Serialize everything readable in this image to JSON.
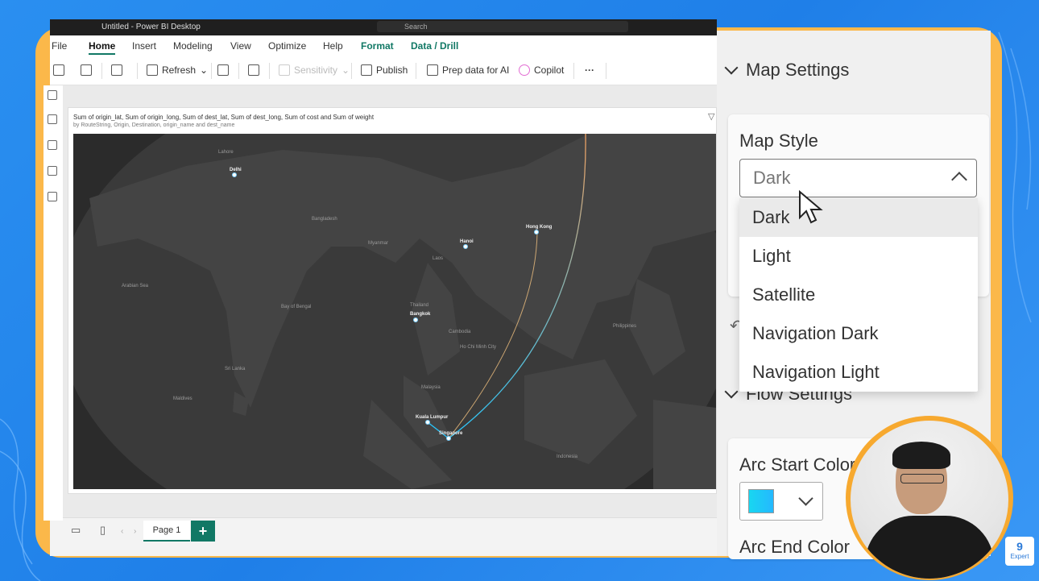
{
  "window": {
    "title": "Untitled - Power BI Desktop",
    "search_placeholder": "Search"
  },
  "menubar": {
    "items": [
      "File",
      "Home",
      "Insert",
      "Modeling",
      "View",
      "Optimize",
      "Help",
      "Format",
      "Data / Drill"
    ],
    "active": "Home"
  },
  "ribbon": {
    "refresh": "Refresh",
    "sensitivity": "Sensitivity",
    "publish": "Publish",
    "prep_data": "Prep data for AI",
    "copilot": "Copilot",
    "more": "···"
  },
  "visual": {
    "title": "Sum of origin_lat, Sum of origin_long, Sum of dest_lat, Sum of dest_long, Sum of cost and Sum of weight",
    "subtitle": "by RouteString, Origin, Destination, origin_name and dest_name"
  },
  "map": {
    "cities": {
      "delhi": "Delhi",
      "hanoi": "Hanoi",
      "hong_kong": "Hong Kong",
      "bangkok": "Bangkok",
      "kuala_lumpur": "Kuala Lumpur",
      "singapore": "Singapore"
    },
    "places": {
      "arabian_sea": "Arabian Sea",
      "bay_of_bengal": "Bay of Bengal",
      "sri_lanka": "Sri Lanka",
      "thailand": "Thailand",
      "myanmar": "Myanmar",
      "malaysia": "Malaysia",
      "indonesia": "Indonesia",
      "philippines": "Philippines",
      "ho_chi_minh": "Ho Chi Minh City",
      "maldives": "Maldives",
      "lahore": "Lahore",
      "bangladesh": "Bangladesh",
      "cambodia": "Cambodia",
      "lao": "Laos"
    },
    "arc_start_color": "#28c8ff",
    "arc_end_color": "#f0a060"
  },
  "pages": {
    "current": "Page 1",
    "add": "+"
  },
  "panel": {
    "map_settings": "Map Settings",
    "map_style_label": "Map Style",
    "map_style_value": "Dark",
    "map_style_options": [
      "Dark",
      "Light",
      "Satellite",
      "Navigation Dark",
      "Navigation Light"
    ],
    "flow_settings": "Flow Settings",
    "arc_start_label": "Arc Start Color",
    "arc_end_label": "Arc End Color"
  },
  "watermark": {
    "label": "Expert",
    "number": "9"
  }
}
